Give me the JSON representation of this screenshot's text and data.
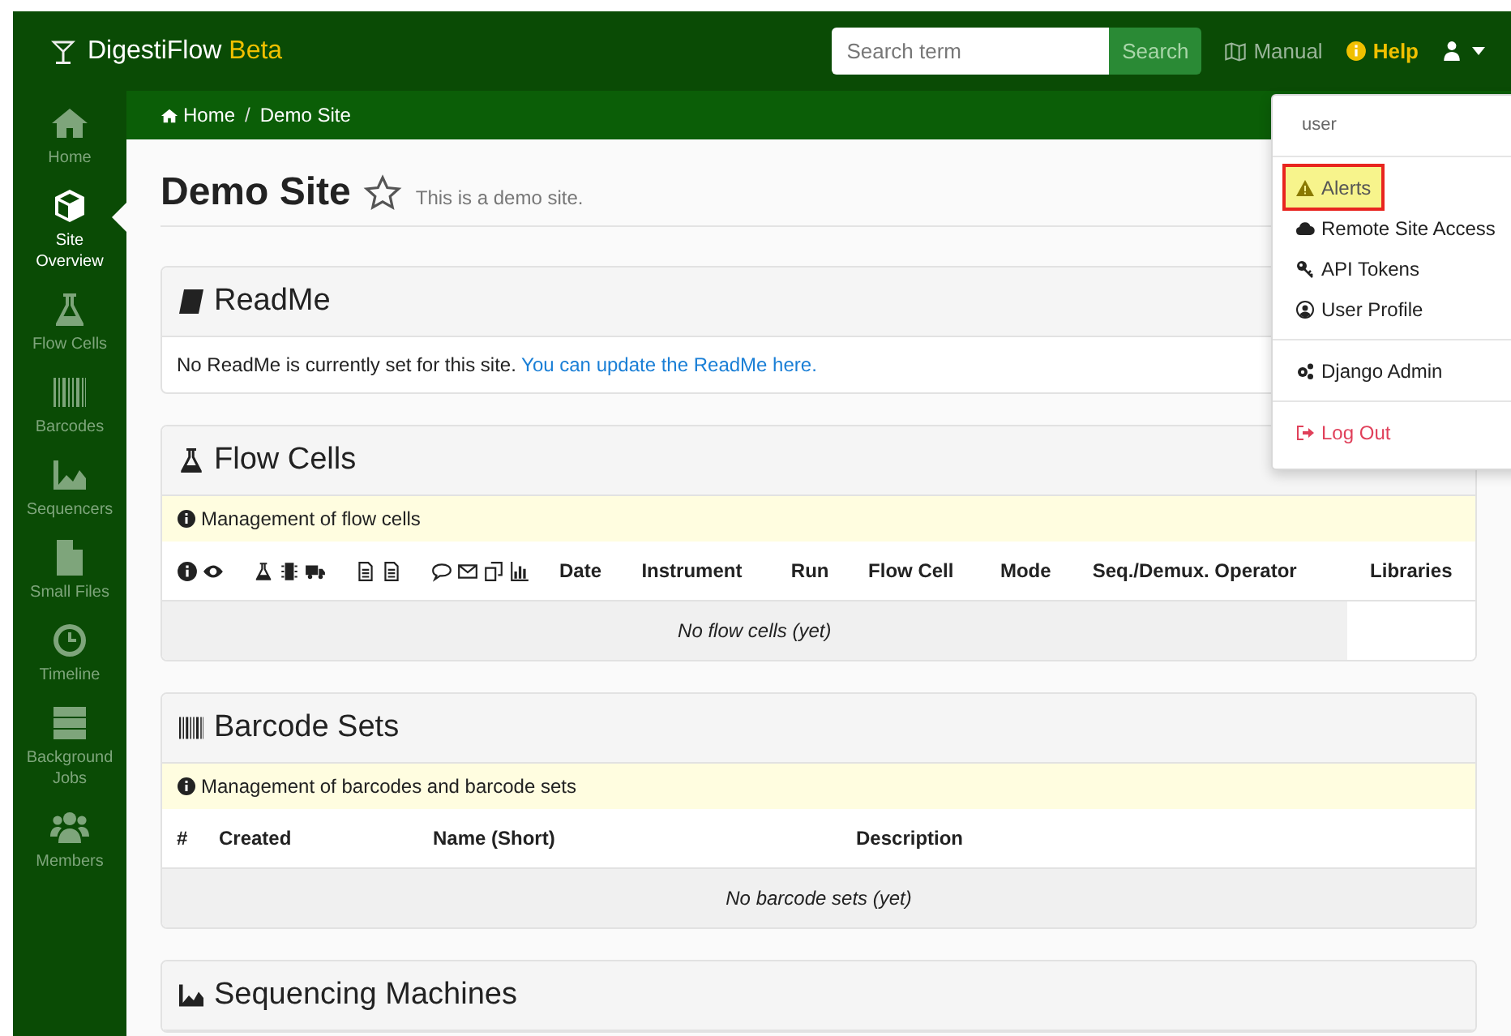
{
  "navbar": {
    "brand": "DigestiFlow",
    "brand_tag": "Beta",
    "search": {
      "placeholder": "Search term",
      "button": "Search"
    },
    "links": [
      {
        "label": "Manual",
        "kind": "muted"
      },
      {
        "label": "Help",
        "kind": "help"
      }
    ]
  },
  "sidebar": {
    "items": [
      {
        "label": "Home",
        "selected": false
      },
      {
        "label": "Site Overview",
        "selected": true
      },
      {
        "label": "Flow Cells",
        "selected": false
      },
      {
        "label": "Barcodes",
        "selected": false
      },
      {
        "label": "Sequencers",
        "selected": false
      },
      {
        "label": "Small Files",
        "selected": false
      },
      {
        "label": "Timeline",
        "selected": false
      },
      {
        "label": "Background Jobs",
        "selected": false
      },
      {
        "label": "Members",
        "selected": false
      }
    ]
  },
  "breadcrumb": {
    "items": [
      "Home",
      "Demo Site"
    ],
    "separator": "/"
  },
  "page": {
    "title": "Demo Site",
    "starred": false,
    "subtitle": "This is a demo site."
  },
  "readme": {
    "title": "ReadMe",
    "text": "No ReadMe is currently set for this site.",
    "link": "You can update the ReadMe here."
  },
  "flow_cells": {
    "title": "Flow Cells",
    "info": "Management of flow cells",
    "columns": [
      "Date",
      "Instrument",
      "Run",
      "Flow Cell",
      "Mode",
      "Seq./Demux. Operator",
      "Libraries"
    ],
    "empty": "No flow cells (yet)"
  },
  "barcode_sets": {
    "title": "Barcode Sets",
    "info": "Management of barcodes and barcode sets",
    "columns": [
      "#",
      "Created",
      "Name (Short)",
      "Description"
    ],
    "empty": "No barcode sets (yet)"
  },
  "sequencing_machines": {
    "title": "Sequencing Machines"
  },
  "user_menu": {
    "header": "user",
    "groups": [
      [
        {
          "label": "Alerts",
          "highlighted": true,
          "kind": "normal"
        },
        {
          "label": "Remote Site Access",
          "highlighted": false,
          "kind": "normal"
        },
        {
          "label": "API Tokens",
          "highlighted": false,
          "kind": "normal"
        },
        {
          "label": "User Profile",
          "highlighted": false,
          "kind": "normal"
        }
      ],
      [
        {
          "label": "Django Admin",
          "highlighted": false,
          "kind": "normal"
        }
      ],
      [
        {
          "label": "Log Out",
          "highlighted": false,
          "kind": "danger"
        }
      ]
    ]
  }
}
